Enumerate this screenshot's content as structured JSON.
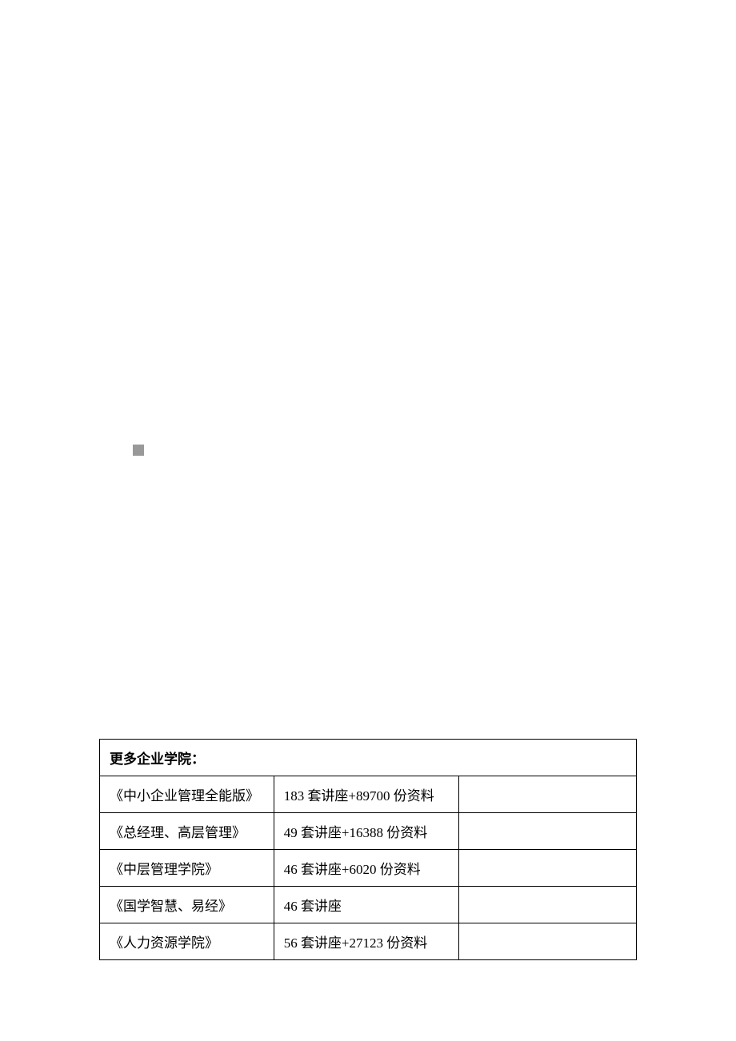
{
  "table": {
    "header": "更多企业学院：",
    "rows": [
      {
        "name": "《中小企业管理全能版》",
        "detail": "183 套讲座+89700 份资料",
        "extra": ""
      },
      {
        "name": "《总经理、高层管理》",
        "detail": "49 套讲座+16388 份资料",
        "extra": ""
      },
      {
        "name": "《中层管理学院》",
        "detail": "46 套讲座+6020 份资料",
        "extra": ""
      },
      {
        "name": "《国学智慧、易经》",
        "detail": "46 套讲座",
        "extra": ""
      },
      {
        "name": "《人力资源学院》",
        "detail": "56 套讲座+27123 份资料",
        "extra": ""
      }
    ]
  }
}
